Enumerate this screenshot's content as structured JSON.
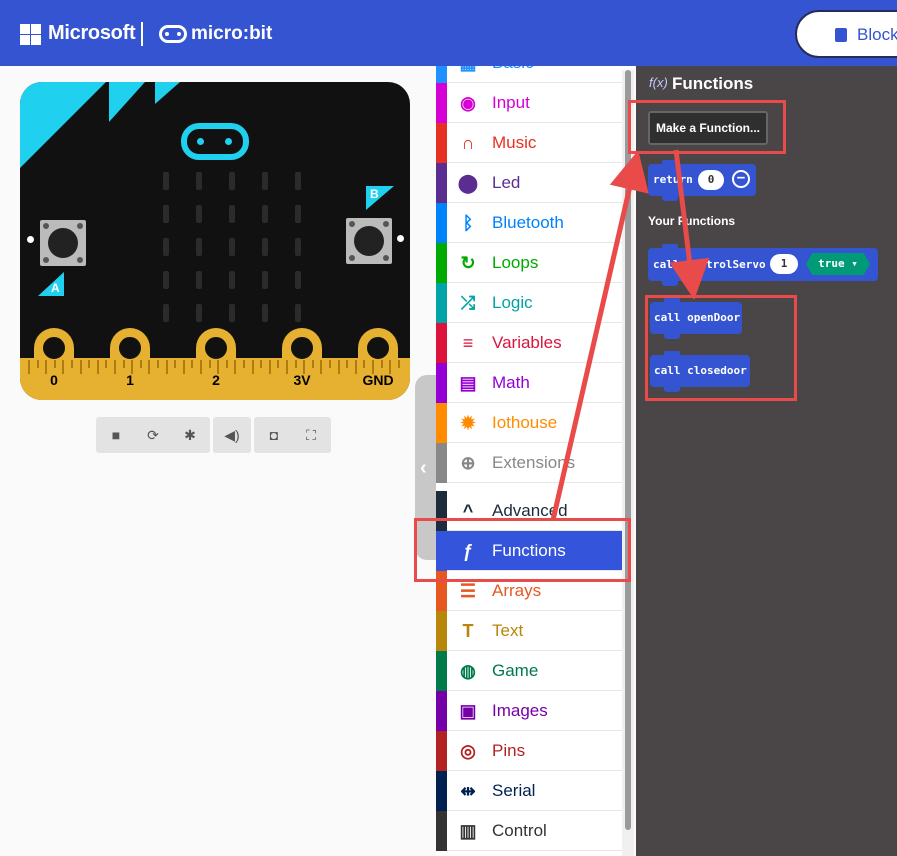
{
  "header": {
    "brand": "Microsoft",
    "product": "micro:bit",
    "editor_toggle_label": "Block",
    "background_color": "#3454d1"
  },
  "simulator": {
    "buttons": {
      "a": "A",
      "b": "B"
    },
    "pins": [
      "0",
      "1",
      "2",
      "3V",
      "GND"
    ],
    "controls": [
      "stop-icon",
      "restart-icon",
      "debug-icon",
      "mute-icon",
      "screenshot-icon",
      "fullscreen-icon"
    ]
  },
  "toolbox": {
    "items": [
      {
        "label": "Basic",
        "color": "#1e90ff",
        "icon": "grid-icon"
      },
      {
        "label": "Input",
        "color": "#d400d4",
        "icon": "target-icon"
      },
      {
        "label": "Music",
        "color": "#e63022",
        "icon": "headphones-icon"
      },
      {
        "label": "Led",
        "color": "#5c2d91",
        "icon": "toggle-icon"
      },
      {
        "label": "Bluetooth",
        "color": "#0082fb",
        "icon": "bluetooth-icon"
      },
      {
        "label": "Loops",
        "color": "#00aa00",
        "icon": "refresh-icon"
      },
      {
        "label": "Logic",
        "color": "#00a4a6",
        "icon": "shuffle-icon"
      },
      {
        "label": "Variables",
        "color": "#dc143c",
        "icon": "lines-icon"
      },
      {
        "label": "Math",
        "color": "#9400d3",
        "icon": "calculator-icon"
      },
      {
        "label": "Iothouse",
        "color": "#ff8c00",
        "icon": "gear-icon"
      },
      {
        "label": "Extensions",
        "color": "#888888",
        "icon": "plus-circle-icon"
      },
      {
        "label": "Advanced",
        "color": "#1d2c3a",
        "icon": "chevron-up-icon"
      },
      {
        "label": "Functions",
        "color": "#3455db",
        "icon": "function-icon"
      },
      {
        "label": "Arrays",
        "color": "#e65722",
        "icon": "list-icon"
      },
      {
        "label": "Text",
        "color": "#b8860b",
        "icon": "text-icon"
      },
      {
        "label": "Game",
        "color": "#007a4b",
        "icon": "gamepad-icon"
      },
      {
        "label": "Images",
        "color": "#7600a8",
        "icon": "image-icon"
      },
      {
        "label": "Pins",
        "color": "#b22222",
        "icon": "pin-icon"
      },
      {
        "label": "Serial",
        "color": "#002050",
        "icon": "usb-icon"
      },
      {
        "label": "Control",
        "color": "#333333",
        "icon": "server-icon"
      }
    ],
    "selected": "Functions"
  },
  "flyout": {
    "title": "Functions",
    "make_function_label": "Make a Function...",
    "return_block": {
      "keyword": "return",
      "value": "0"
    },
    "your_functions_label": "Your Functions",
    "calls": [
      {
        "text": "call controlServo",
        "arg": "1",
        "bool": "true"
      },
      {
        "text": "call openDoor"
      },
      {
        "text": "call closedoor"
      }
    ]
  }
}
